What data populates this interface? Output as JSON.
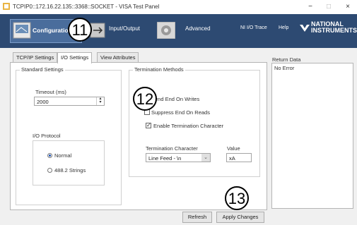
{
  "window": {
    "title": "TCPIP0::172.16.22.135::3368::SOCKET - VISA Test Panel",
    "minimize": "−",
    "maximize": "□",
    "close": "×"
  },
  "toolbar": {
    "configuration": "Configuration",
    "input_output": "Input/Output",
    "advanced": "Advanced",
    "ni_io_trace": "NI I/O Trace",
    "help": "Help",
    "logo_line1": "NATIONAL",
    "logo_line2": "INSTRUMENTS"
  },
  "tabs": [
    {
      "label": "TCP/IP Settings"
    },
    {
      "label": "I/O Settings"
    },
    {
      "label": "View Attributes"
    }
  ],
  "standard_settings": {
    "title": "Standard Settings",
    "timeout_label": "Timeout (ms)",
    "timeout_value": "2000",
    "io_protocol_label": "I/O Protocol",
    "normal": "Normal",
    "strings": "488.2 Strings"
  },
  "termination": {
    "title": "Termination Methods",
    "send_end": "Send End On Writes",
    "suppress_end": "Suppress End On Reads",
    "enable_term": "Enable Termination Character",
    "term_char_label": "Termination Character",
    "term_char_value": "Line Feed - \\n",
    "value_label": "Value",
    "value_value": "xA"
  },
  "return_data": {
    "label": "Return Data",
    "value": "No Error"
  },
  "buttons": {
    "refresh": "Refresh",
    "apply": "Apply Changes"
  },
  "callouts": {
    "c11": "11",
    "c12": "12",
    "c13": "13"
  }
}
